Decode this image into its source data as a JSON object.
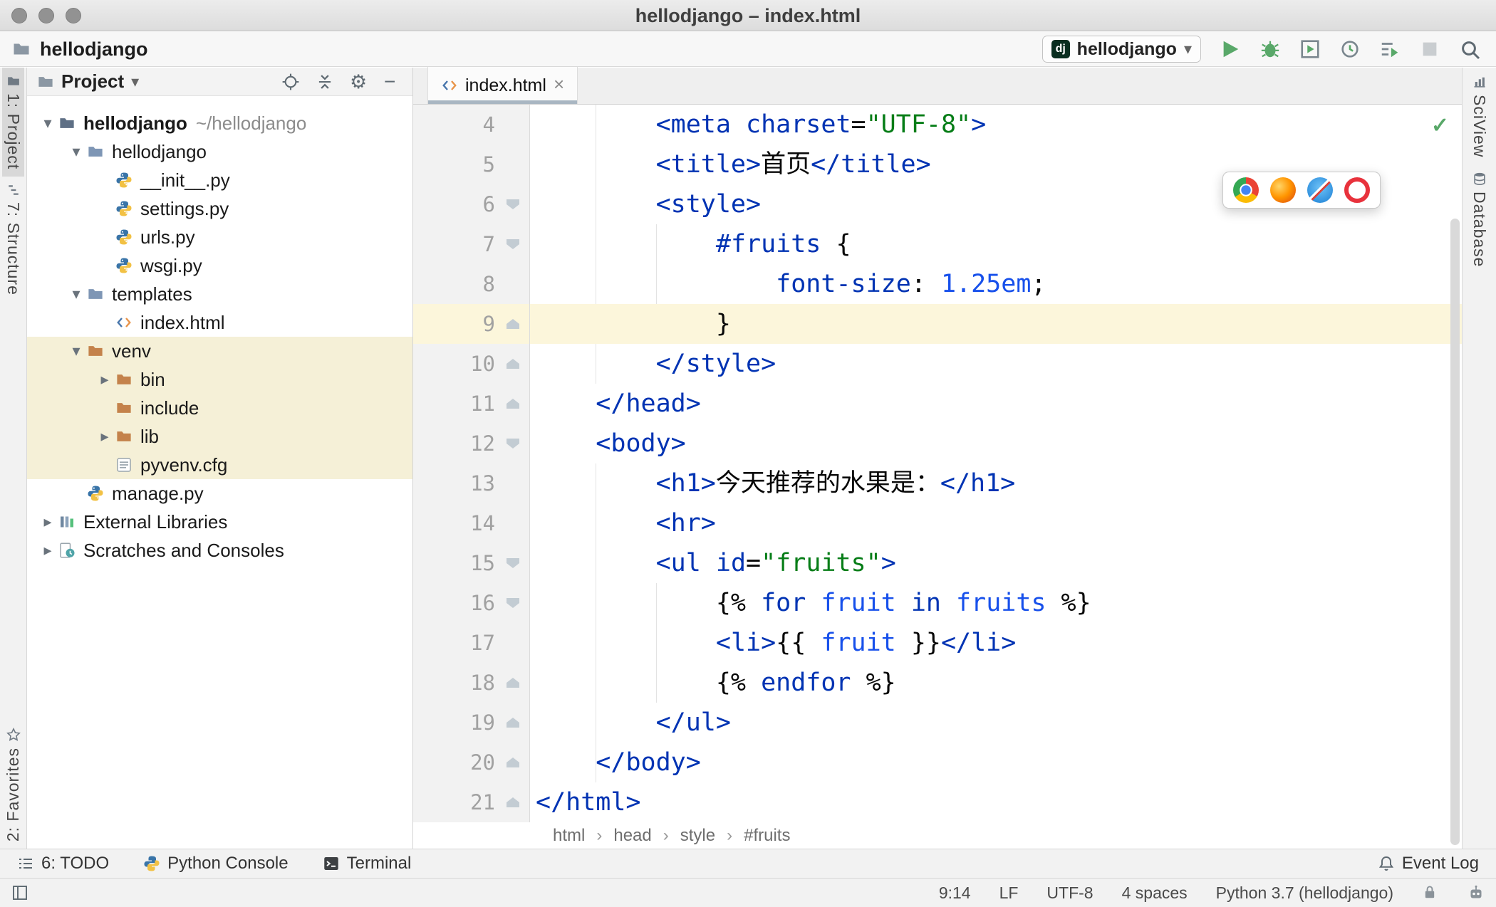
{
  "colors": {
    "kw": "#0033b3",
    "str": "#067d17",
    "num": "#1750eb",
    "plain": "#080808",
    "caretline": "#fcf6db",
    "excluded": "#f5f0d7",
    "green": "#59a869"
  },
  "title_bar": {
    "title": "hellodjango – index.html"
  },
  "toolbar": {
    "project": "hellodjango",
    "run_config": "hellodjango",
    "dj_badge": "dj"
  },
  "left_stripe": {
    "project": "1: Project",
    "structure": "7: Structure",
    "favorites": "2: Favorites"
  },
  "right_stripe": {
    "sciview": "SciView",
    "database": "Database"
  },
  "project_panel": {
    "header": "Project",
    "tree": [
      {
        "label": "hellodjango",
        "extra": "~/hellodjango"
      },
      {
        "label": "hellodjango"
      },
      {
        "label": "__init__.py"
      },
      {
        "label": "settings.py"
      },
      {
        "label": "urls.py"
      },
      {
        "label": "wsgi.py"
      },
      {
        "label": "templates"
      },
      {
        "label": "index.html"
      },
      {
        "label": "venv"
      },
      {
        "label": "bin"
      },
      {
        "label": "include"
      },
      {
        "label": "lib"
      },
      {
        "label": "pyvenv.cfg"
      },
      {
        "label": "manage.py"
      },
      {
        "label": "External Libraries"
      },
      {
        "label": "Scratches and Consoles"
      }
    ]
  },
  "editor": {
    "tab": "index.html",
    "crumb_sep": "›",
    "breadcrumbs": [
      "html",
      "head",
      "style",
      "#fruits"
    ],
    "lines": [
      {
        "num": "4",
        "seg": [
          [
            "p",
            "        "
          ],
          [
            "k",
            "<meta"
          ],
          [
            "p",
            " "
          ],
          [
            "k",
            "charset"
          ],
          [
            "p",
            "="
          ],
          [
            "s",
            "\"UTF-8\""
          ],
          [
            "k",
            ">"
          ]
        ]
      },
      {
        "num": "5",
        "seg": [
          [
            "p",
            "        "
          ],
          [
            "k",
            "<title>"
          ],
          [
            "p",
            "首页"
          ],
          [
            "k",
            "</title>"
          ]
        ]
      },
      {
        "num": "6",
        "marker": "down",
        "seg": [
          [
            "p",
            "        "
          ],
          [
            "k",
            "<style>"
          ]
        ]
      },
      {
        "num": "7",
        "marker": "down",
        "seg": [
          [
            "p",
            "            "
          ],
          [
            "k",
            "#fruits"
          ],
          [
            "p",
            " {"
          ]
        ]
      },
      {
        "num": "8",
        "seg": [
          [
            "p",
            "                "
          ],
          [
            "k",
            "font-size"
          ],
          [
            "p",
            ": "
          ],
          [
            "v",
            "1.25em"
          ],
          [
            "p",
            ";"
          ]
        ]
      },
      {
        "num": "9",
        "marker": "up",
        "hl": true,
        "seg": [
          [
            "p",
            "            }"
          ]
        ]
      },
      {
        "num": "10",
        "marker": "up",
        "seg": [
          [
            "p",
            "        "
          ],
          [
            "k",
            "</style>"
          ]
        ]
      },
      {
        "num": "11",
        "marker": "up",
        "seg": [
          [
            "p",
            "    "
          ],
          [
            "k",
            "</head>"
          ]
        ]
      },
      {
        "num": "12",
        "marker": "down",
        "seg": [
          [
            "p",
            "    "
          ],
          [
            "k",
            "<body>"
          ]
        ]
      },
      {
        "num": "13",
        "seg": [
          [
            "p",
            "        "
          ],
          [
            "k",
            "<h1>"
          ],
          [
            "p",
            "今天推荐的水果是："
          ],
          [
            "k",
            "</h1>"
          ]
        ]
      },
      {
        "num": "14",
        "seg": [
          [
            "p",
            "        "
          ],
          [
            "k",
            "<hr>"
          ]
        ]
      },
      {
        "num": "15",
        "marker": "down",
        "seg": [
          [
            "p",
            "        "
          ],
          [
            "k",
            "<ul"
          ],
          [
            "p",
            " "
          ],
          [
            "k",
            "id"
          ],
          [
            "p",
            "="
          ],
          [
            "s",
            "\"fruits\""
          ],
          [
            "k",
            ">"
          ]
        ]
      },
      {
        "num": "16",
        "marker": "down",
        "seg": [
          [
            "p",
            "            {% "
          ],
          [
            "k",
            "for"
          ],
          [
            "p",
            " "
          ],
          [
            "v",
            "fruit"
          ],
          [
            "p",
            " "
          ],
          [
            "k",
            "in"
          ],
          [
            "p",
            " "
          ],
          [
            "v",
            "fruits"
          ],
          [
            "p",
            " %}"
          ]
        ]
      },
      {
        "num": "17",
        "seg": [
          [
            "p",
            "            "
          ],
          [
            "k",
            "<li>"
          ],
          [
            "p",
            "{{ "
          ],
          [
            "v",
            "fruit"
          ],
          [
            "p",
            " }}"
          ],
          [
            "k",
            "</li>"
          ]
        ]
      },
      {
        "num": "18",
        "marker": "up",
        "seg": [
          [
            "p",
            "            {% "
          ],
          [
            "k",
            "endfor"
          ],
          [
            "p",
            " %}"
          ]
        ]
      },
      {
        "num": "19",
        "marker": "up",
        "seg": [
          [
            "p",
            "        "
          ],
          [
            "k",
            "</ul>"
          ]
        ]
      },
      {
        "num": "20",
        "marker": "up",
        "seg": [
          [
            "p",
            "    "
          ],
          [
            "k",
            "</body>"
          ]
        ]
      },
      {
        "num": "21",
        "marker": "up",
        "seg": [
          [
            "k",
            "</html>"
          ]
        ]
      }
    ]
  },
  "bottom_bar": {
    "todo": "6: TODO",
    "python_console": "Python Console",
    "terminal": "Terminal",
    "event_log": "Event Log"
  },
  "status_bar": {
    "position": "9:14",
    "line_sep": "LF",
    "encoding": "UTF-8",
    "indent": "4 spaces",
    "interpreter": "Python 3.7 (hellodjango)"
  }
}
